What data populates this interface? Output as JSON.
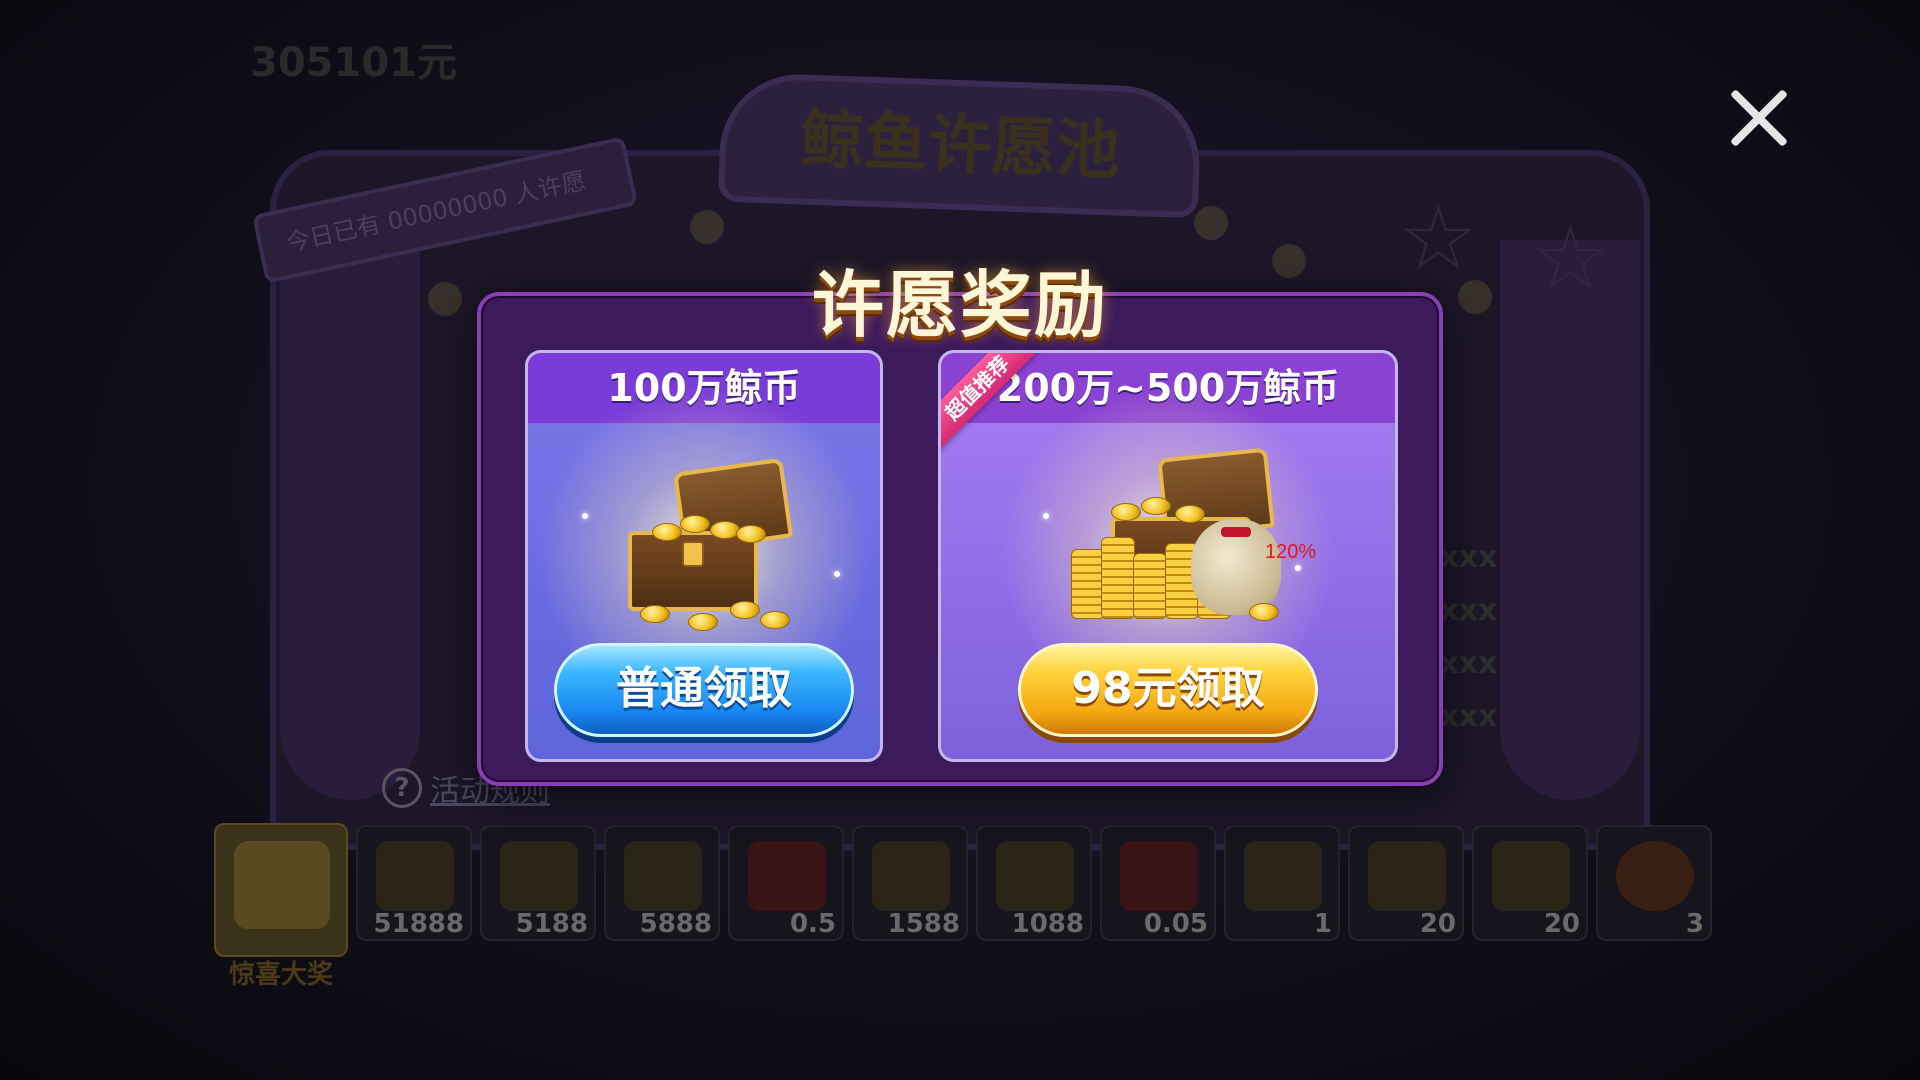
{
  "background": {
    "topbar_text": "305101元",
    "marquee_title": "鲸鱼许愿池",
    "banner_text": "今日已有 00000000 人许愿",
    "rank_values": [
      "xxxx",
      "xxxx",
      "xxxx",
      "xxxx"
    ],
    "help_label": "活动规则",
    "reward_strip": [
      {
        "qty": "",
        "caption": "惊喜大奖",
        "featured": true
      },
      {
        "qty": "51888"
      },
      {
        "qty": "5188"
      },
      {
        "qty": "5888"
      },
      {
        "qty": "0.5"
      },
      {
        "qty": "1588"
      },
      {
        "qty": "1088"
      },
      {
        "qty": "0.05"
      },
      {
        "qty": "1"
      },
      {
        "qty": "20"
      },
      {
        "qty": "20"
      },
      {
        "qty": "3"
      }
    ]
  },
  "modal": {
    "title": "许愿奖励",
    "cards": [
      {
        "header": "100万鲸币",
        "button_label": "普通领取"
      },
      {
        "header": "200万~500万鲸币",
        "ribbon": "超值推荐",
        "percent_label": "120%",
        "button_label": "98元领取"
      }
    ]
  },
  "colors": {
    "modal_bg": "#3d1a5c",
    "modal_border": "#8a3fb4",
    "button_blue": "#1886f0",
    "button_gold": "#f4a814",
    "ribbon_pink": "#d42a70"
  }
}
